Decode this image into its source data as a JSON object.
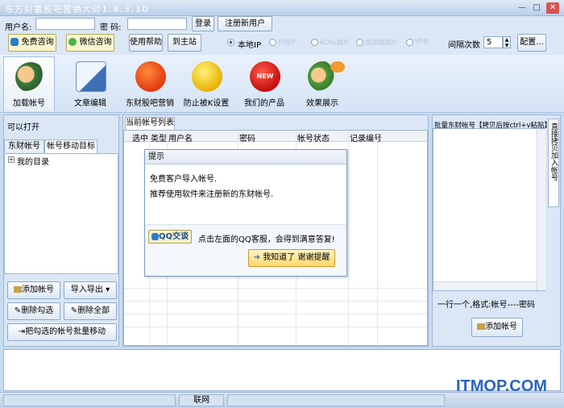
{
  "window": {
    "title": "东方财富股吧营销大师1.8.3.10",
    "controls": {
      "minimize": "—",
      "maximize": "□",
      "close": "✕"
    }
  },
  "login": {
    "username_label": "用户名:",
    "password_label": "密  码:",
    "login_button": "登录",
    "register_button": "注册新用户"
  },
  "top_buttons": {
    "free_consult": "免费咨询",
    "wechat_consult": "微信咨询",
    "help": "使用帮助",
    "home": "到主站"
  },
  "network": {
    "options": [
      "本地IP",
      "代理IP",
      "ADSL换IP",
      "加速器换IP",
      "VPN"
    ],
    "selected": "本地IP"
  },
  "interval": {
    "label": "间隔次数",
    "value": "5"
  },
  "config_button": "配置...",
  "toolbar": {
    "items": [
      {
        "label": "加载帐号",
        "icon": "user-money-icon"
      },
      {
        "label": "文章编辑",
        "icon": "edit-document-icon"
      },
      {
        "label": "东财股吧营销",
        "icon": "guba-logo-icon"
      },
      {
        "label": "防止被K设置",
        "icon": "wrench-icon"
      },
      {
        "label": "我们的产品",
        "icon": "new-badge-icon"
      },
      {
        "label": "效果展示",
        "icon": "user-quote-icon"
      }
    ]
  },
  "left": {
    "title": "可以打开",
    "tabs": [
      "东财帐号",
      "帐号移动目标"
    ],
    "tree_root": "我的目录",
    "buttons": {
      "add_account": "添加帐号",
      "import_export": "导入导出",
      "delete_checked": "删除勾选",
      "delete_all": "删除全部",
      "batch_move": "把勾选的帐号批量移动"
    }
  },
  "center": {
    "tab": "当前帐号列表",
    "columns": [
      "选中",
      "类型",
      "用户名",
      "密码",
      "帐号状态",
      "记录编号"
    ]
  },
  "dialog": {
    "title": "提示",
    "line1": "免费客户导入帐号.",
    "line2": "推荐使用软件来注册新的东财帐号.",
    "qq_button": "QQ交谈",
    "qq_text": "点击左面的QQ客服，会得到满意答复!",
    "ok_button": "我知道了 谢谢提醒"
  },
  "right": {
    "title": "批量东财帐号【拷贝后按ctrl+v粘贴】",
    "side_tab": "直接拷贝加入帐号",
    "format_hint": "一行一个,格式:帐号----密码",
    "add_button": "添加帐号"
  },
  "status": {
    "network": "联网"
  },
  "watermark": "ITMOP.COM"
}
